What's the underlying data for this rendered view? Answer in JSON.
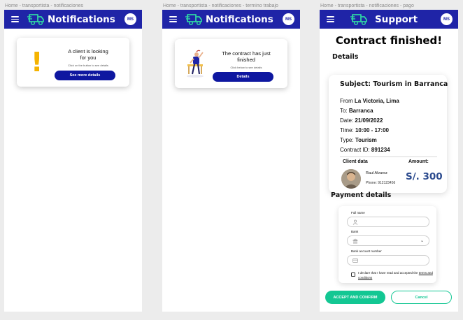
{
  "screens": [
    {
      "breadcrumb": "Home - transportista - notificaciones",
      "title": "Notifications",
      "avatar_initials": "MS",
      "card": {
        "icon": "exclamation-icon",
        "message": "A client is looking for you",
        "hint": "Click on the button to see details",
        "button": "See more details"
      }
    },
    {
      "breadcrumb": "Home - transportista - notificaciones - termino trabajo",
      "title": "Notifications",
      "avatar_initials": "MS",
      "card": {
        "icon": "worker-illustration",
        "message": "The contract has just finished",
        "hint": "Click below to see details",
        "button": "Details"
      }
    },
    {
      "breadcrumb": "Home - transportista - notificaciones - pago",
      "title": "Support",
      "avatar_initials": "MS",
      "heading": "Contract finished!",
      "details_title": "Details",
      "details": {
        "subject": "Subject: Tourism in Barranca",
        "rows": [
          {
            "label": "From",
            "value": "La Victoria, Lima"
          },
          {
            "label": "To:",
            "value": "Barranca"
          },
          {
            "label": "Date:",
            "value": "21/09/2022"
          },
          {
            "label": "Time:",
            "value": "10:00 - 17:00"
          },
          {
            "label": "Type:",
            "value": "Tourism"
          },
          {
            "label": "Contract ID:",
            "value": "891234"
          }
        ],
        "client_label": "Client data",
        "amount_label": "Amount:",
        "client_name": "Raul Alvarez",
        "client_phone": "Phone: 912123456",
        "amount": "S/. 300"
      },
      "payment": {
        "title": "Payment details",
        "full_name_label": "Full name",
        "bank_label": "Bank",
        "account_label": "Bank account number",
        "declaration_text": "I declare that I have read and accepted the",
        "terms_link": "terms and conditions"
      },
      "accept_button": "ACCEPT AND CONFIRM",
      "cancel_button": "Cancel"
    }
  ],
  "colors": {
    "appbar": "#1f24a7",
    "primary_button": "#0e17a0",
    "accent_green": "#13c793",
    "amount": "#2d4c8f",
    "warning": "#f5b300"
  }
}
